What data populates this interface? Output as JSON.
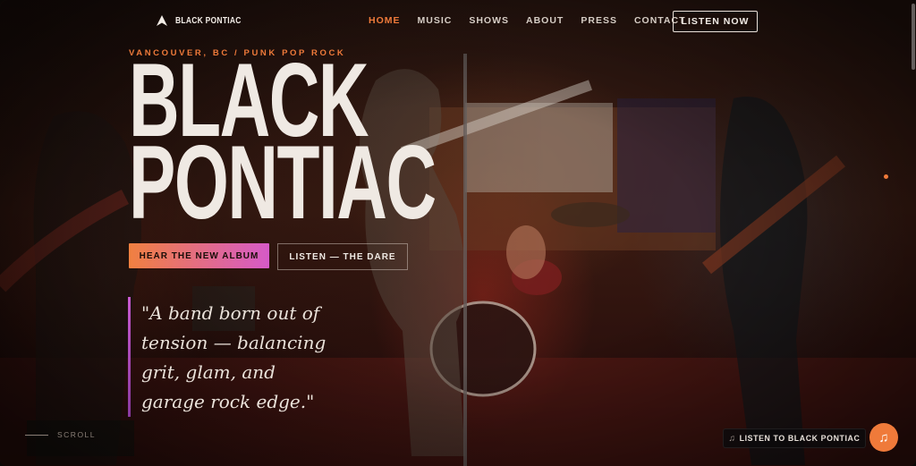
{
  "brand": {
    "name": "BLACK PONTIAC",
    "icon": "arrow-logo-icon"
  },
  "nav": {
    "items": [
      {
        "label": "HOME",
        "active": true
      },
      {
        "label": "MUSIC",
        "active": false
      },
      {
        "label": "SHOWS",
        "active": false
      },
      {
        "label": "ABOUT",
        "active": false
      },
      {
        "label": "PRESS",
        "active": false
      },
      {
        "label": "CONTACT",
        "active": false
      }
    ],
    "cta": "LISTEN NOW"
  },
  "hero": {
    "kicker": "VANCOUVER, BC / PUNK POP ROCK",
    "title_line1": "BLACK",
    "title_line2": "PONTIAC",
    "primary_cta": "HEAR THE NEW ALBUM",
    "secondary_cta": "LISTEN — THE DARE",
    "quote": "\"A band born out of tension — balancing grit, glam, and garage rock edge.\""
  },
  "scroll_hint": "SCROLL",
  "player": {
    "label": "LISTEN TO BLACK PONTIAC",
    "icon": "music-note-icon",
    "button_icon": "music-note-icon"
  },
  "colors": {
    "accent": "#ef7a3a",
    "gradient_end": "#d65ac8",
    "quote_bar": "#c85ad0"
  }
}
